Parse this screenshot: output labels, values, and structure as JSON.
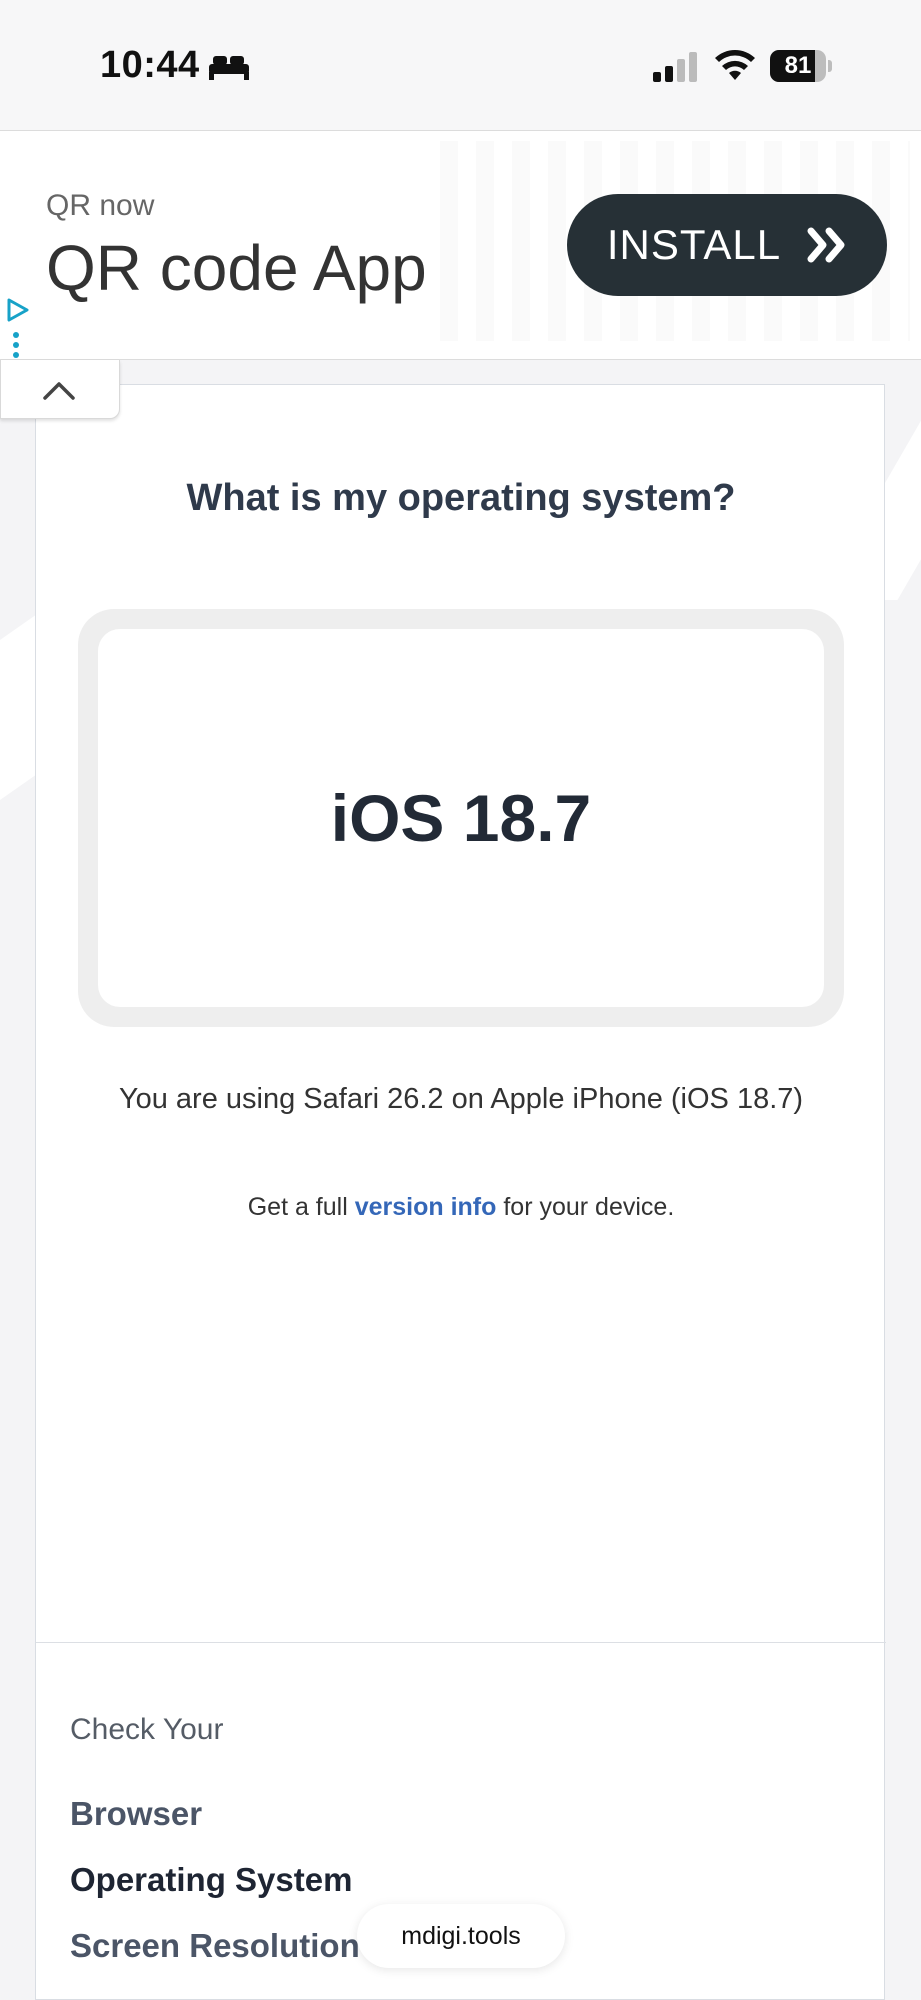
{
  "status_bar": {
    "time": "10:44",
    "battery_percent": "81",
    "battery_level": 0.81,
    "icons": [
      "bed-icon",
      "cellular-signal-icon",
      "wifi-icon",
      "battery-icon"
    ]
  },
  "ad": {
    "subtitle": "QR now",
    "title": "QR code App",
    "install_label": "INSTALL",
    "icons": [
      "adchoices-icon",
      "ad-menu-icon",
      "double-chevron-right-icon",
      "chevron-up-icon"
    ],
    "button_color": "#263036"
  },
  "main": {
    "title": "What is my operating system?",
    "os_value": "iOS 18.7",
    "usage_text": "You are using Safari 26.2 on Apple iPhone (iOS 18.7)",
    "version_prefix": "Get a full ",
    "version_link": "version info",
    "version_suffix": " for your device.",
    "link_color": "#3467b8"
  },
  "check_section": {
    "heading": "Check Your",
    "links": [
      {
        "label": "Browser",
        "active": false
      },
      {
        "label": "Operating System",
        "active": true
      },
      {
        "label": "Screen Resolution",
        "active": false
      }
    ]
  },
  "url_bar": {
    "domain": "mdigi.tools"
  }
}
